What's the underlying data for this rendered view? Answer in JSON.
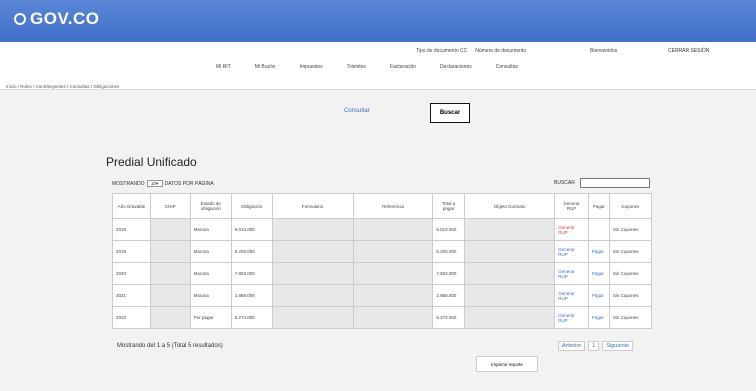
{
  "brand": {
    "logo_text": "GOV.CO",
    "accent": "#3f6fc8"
  },
  "header": {
    "doc_type": "Tipo de documento CC",
    "doc_number": "Número de documento",
    "welcome": "Bienvenidos",
    "logout": "CERRAR SESIÓN",
    "nav": [
      "Mi RIT",
      "Mi Buzón",
      "Impuestos",
      "Trámites",
      "Facturación",
      "Declaraciones",
      "Consultas"
    ]
  },
  "breadcrumb": "Inicio  /  Roles  /  Contribuyentes  /  Consultas  /  Obligaciones",
  "actions": {
    "consultar": "Consultar",
    "buscar": "Buscar"
  },
  "main": {
    "title": "Predial Unificado",
    "show_prefix": "MOSTRANDO",
    "page_size": "10",
    "show_suffix": "DATOS POR PÁGINA",
    "search_label": "BUSCAR",
    "search_value": "",
    "columns": [
      "Año Gravable",
      "CHIP",
      "Estado de obligación",
      "Obligación",
      "Formulario",
      "Referencia",
      "Total a pagar",
      "Objeto Contrato",
      "Generar RUP",
      "Pagar",
      "Cupones"
    ],
    "rows": [
      {
        "year": "2018",
        "estado": "Morosa",
        "obligacion": "5.013.000",
        "total": "5.013.000",
        "generar": "Generar RUP",
        "pagar": "",
        "cupones": "Sin Cupones"
      },
      {
        "year": "2019",
        "estado": "Morosa",
        "obligacion": "6.200.000",
        "total": "6.200.000",
        "generar": "Generar RUP",
        "pagar": "Pagar",
        "cupones": "Sin Cupones"
      },
      {
        "year": "2020",
        "estado": "Morosa",
        "obligacion": "7.853.000",
        "total": "7.853.000",
        "generar": "Generar RUP",
        "pagar": "Pagar",
        "cupones": "Sin Cupones"
      },
      {
        "year": "2021",
        "estado": "Morosa",
        "obligacion": "2.868.000",
        "total": "2.868.000",
        "generar": "Generar RUP",
        "pagar": "Pagar",
        "cupones": "Sin Cupones"
      },
      {
        "year": "2022",
        "estado": "Por pagar",
        "obligacion": "5.274.000",
        "total": "5.274.000",
        "generar": "Generar RUP",
        "pagar": "Pagar",
        "cupones": "Sin Cupones"
      }
    ],
    "summary": "Mostrando del 1 a 5 (Total 5 resultados)",
    "pager": {
      "prev": "Anterior",
      "page": "1",
      "next": "Siguiente"
    },
    "print": "Imprimir reporte"
  }
}
